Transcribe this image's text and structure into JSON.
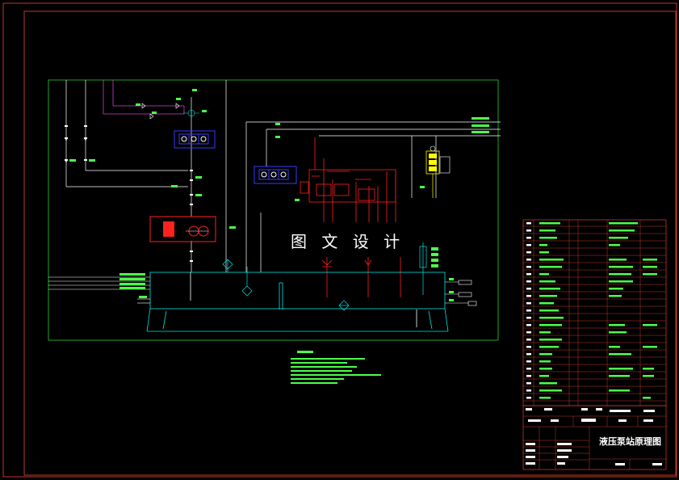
{
  "watermark": "图 文 设 计",
  "title_block": {
    "drawing_title": "液压泵站原理图"
  },
  "colors": {
    "frame": "#c0392b",
    "inner_border": "#2ecc2e",
    "hydraulic_lines": "#00e5e5",
    "pilot_lines": "#d040d0",
    "valve_blue": "#3a3aff",
    "valve_red": "#ff2020",
    "solenoid_yellow": "#ffff00",
    "text_green": "#4cff4c",
    "text_white": "#ffffff"
  },
  "icons": {
    "pump_motor": "pump-motor-icon",
    "directional_valve_blue": "directional-valve-icon",
    "proportional_valve_red": "proportional-valve-icon",
    "solenoid_block": "solenoid-valve-icon",
    "filter": "filter-icon",
    "check_valve": "check-valve-icon",
    "tank": "oil-tank-icon"
  }
}
